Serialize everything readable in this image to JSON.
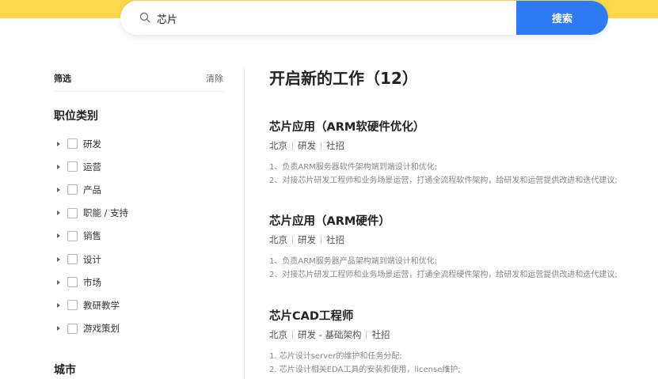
{
  "search": {
    "query": "芯片",
    "button_label": "搜索"
  },
  "sidebar": {
    "filter_title": "筛选",
    "clear_label": "清除",
    "category_title": "职位类别",
    "categories": [
      {
        "label": "研发"
      },
      {
        "label": "运营"
      },
      {
        "label": "产品"
      },
      {
        "label": "职能 / 支持"
      },
      {
        "label": "销售"
      },
      {
        "label": "设计"
      },
      {
        "label": "市场"
      },
      {
        "label": "教研教学"
      },
      {
        "label": "游戏策划"
      }
    ],
    "city_title": "城市"
  },
  "main": {
    "title": "开启新的工作（12）",
    "jobs": [
      {
        "title": "芯片应用（ARM软硬件优化）",
        "meta": [
          "北京",
          "研发",
          "社招"
        ],
        "desc": [
          "1、负责ARM服务器软件架构端到端设计和优化;",
          "2、对接芯片研发工程师和业务场景运营，打通全流程软件架构，给研发和运营提供改进和迭代建议;"
        ]
      },
      {
        "title": "芯片应用（ARM硬件）",
        "meta": [
          "北京",
          "研发",
          "社招"
        ],
        "desc": [
          "1、负责ARM服务器产品架构端到端设计和优化;",
          "2、对接芯片研发工程师和业务场景运营，打通全流程硬件架构，给研发和运营提供改进和迭代建议;"
        ]
      },
      {
        "title": "芯片CAD工程师",
        "meta": [
          "北京",
          "研发 - 基础架构",
          "社招"
        ],
        "desc": [
          "1. 芯片设计server的维护和任务分配;",
          "2. 芯片设计相关EDA工具的安装和使用，license维护;"
        ]
      }
    ]
  },
  "colors": {
    "accent_yellow": "#FBD84A",
    "button_blue": "#2F7BF5"
  }
}
